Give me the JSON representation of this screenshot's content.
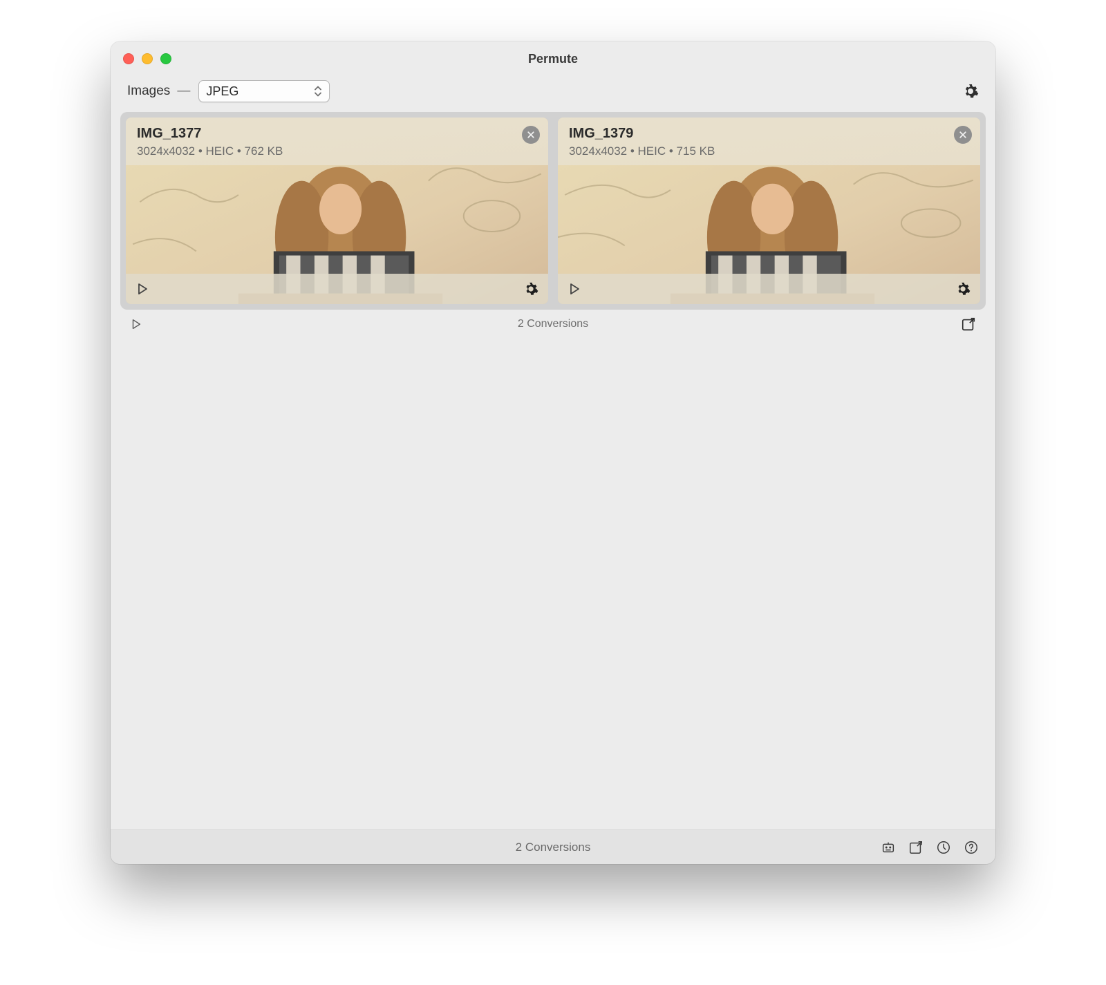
{
  "window": {
    "title": "Permute"
  },
  "toolbar": {
    "category_label": "Images",
    "format_selected": "JPEG"
  },
  "group": {
    "status": "2 Conversions",
    "items": [
      {
        "name": "IMG_1377",
        "meta": "3024x4032 • HEIC • 762 KB"
      },
      {
        "name": "IMG_1379",
        "meta": "3024x4032 • HEIC • 715 KB"
      }
    ]
  },
  "statusbar": {
    "text": "2 Conversions"
  }
}
